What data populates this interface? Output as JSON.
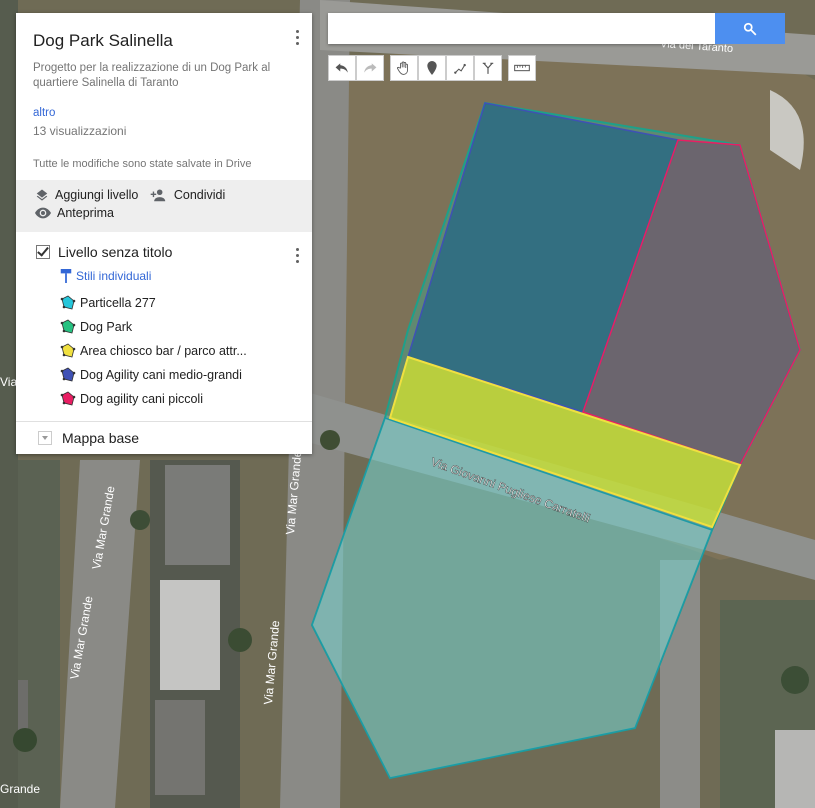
{
  "panel": {
    "title": "Dog Park Salinella",
    "description": "Progetto per la realizzazione di un Dog Park al quartiere Salinella di Taranto",
    "more_link": "altro",
    "views": "13 visualizzazioni",
    "saved_status": "Tutte le modifiche sono state salvate in Drive"
  },
  "actions": {
    "add_layer": "Aggiungi livello",
    "share": "Condividi",
    "preview": "Anteprima"
  },
  "layer": {
    "title": "Livello senza titolo",
    "styles_link": "Stili individuali",
    "items": [
      {
        "label": "Particella 277",
        "color": "#26c6da"
      },
      {
        "label": "Dog Park",
        "color": "#26c281"
      },
      {
        "label": "Area chiosco bar / parco attr...",
        "color": "#f0e040"
      },
      {
        "label": "Dog Agility cani medio-grandi",
        "color": "#3f51b5"
      },
      {
        "label": "Dog agility cani piccoli",
        "color": "#e91e63"
      }
    ]
  },
  "basemap": {
    "label": "Mappa base"
  },
  "search": {
    "placeholder": ""
  },
  "map_labels": {
    "street_1": "Via Giovanni Pugliese Carratelli",
    "street_2": "Via Mar Grande",
    "street_3": "Via Mar Grande",
    "street_4": "Via Mar Grande",
    "street_5": "Via Mar Grande",
    "street_6": "Grande",
    "street_7": "Via",
    "street_top": "Via del Taranto"
  }
}
